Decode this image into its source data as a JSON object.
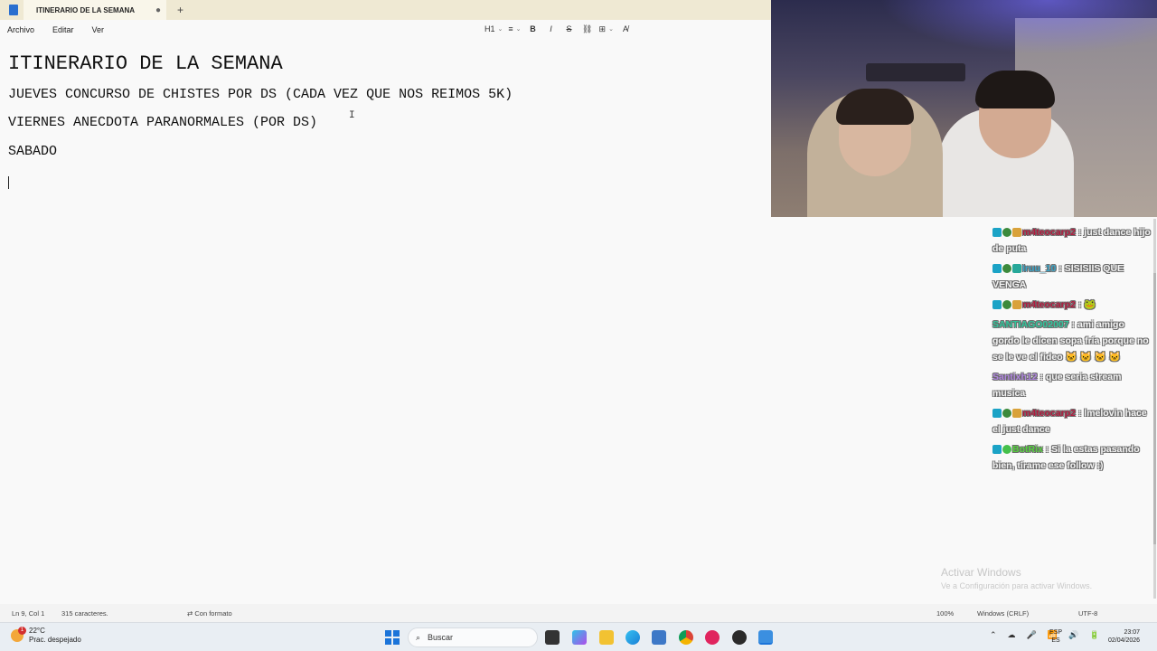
{
  "tab": {
    "title": "ITINERARIO DE LA SEMANA",
    "unsaved_dot": "●",
    "new_tab": "+"
  },
  "menu": {
    "file": "Archivo",
    "edit": "Editar",
    "view": "Ver"
  },
  "toolbar": {
    "heading": "H1",
    "list": "≡",
    "bold": "B",
    "italic": "I",
    "strike": "S",
    "link": "⛓",
    "table": "⊞",
    "clear": "A̸",
    "caret": "⌄"
  },
  "document": {
    "title": "ITINERARIO DE LA SEMANA",
    "lines": [
      "JUEVES CONCURSO DE CHISTES POR DS (CADA VEZ QUE NOS REIMOS 5K)",
      "VIERNES ANECDOTA PARANORMALES (POR DS)",
      "SABADO"
    ]
  },
  "chat": [
    {
      "user": "m4teocarp2",
      "user_color": "#b31b3f",
      "badges": [
        "mod",
        "tree",
        "gift"
      ],
      "text": " : just dance hijo de puta"
    },
    {
      "user": "Iruu_10",
      "user_color": "#39a5c9",
      "badges": [
        "mod",
        "tree",
        "sub"
      ],
      "text": " : SISISIIS QUE VENGA"
    },
    {
      "user": "m4teocarp2",
      "user_color": "#b31b3f",
      "badges": [
        "mod",
        "tree",
        "gift"
      ],
      "text": " : 🐸"
    },
    {
      "user": "SANTIAGO02007",
      "user_color": "#2fc49a",
      "badges": [],
      "text": " : ami amigo gordo le dicen sopa fría porque no se le ve el fideo 🐱 🐱 🐱 🐱"
    },
    {
      "user": "Santixh12",
      "user_color": "#b085e0",
      "badges": [],
      "text": " : que seria stream musica"
    },
    {
      "user": "m4teocarp2",
      "user_color": "#b31b3f",
      "badges": [
        "mod",
        "tree",
        "gift"
      ],
      "text": " : lmelovin hace el just dance"
    },
    {
      "user": "BotRix",
      "user_color": "#54d43b",
      "badges": [
        "mod",
        "verified"
      ],
      "text": " : Si la estas pasando bien, tírame ese follow :)"
    }
  ],
  "watermark": {
    "line1": "Activar Windows",
    "line2": "Ve a Configuración para activar Windows."
  },
  "status": {
    "position": "Ln 9, Col 1",
    "chars": "315 caracteres.",
    "format": "Con formato",
    "zoom": "100%",
    "eol": "Windows (CRLF)",
    "encoding": "UTF-8"
  },
  "taskbar": {
    "temp": "22°C",
    "weather": "Prac. despejado",
    "notif_count": "1",
    "search_placeholder": "Buscar",
    "search_icon": "⌕",
    "lang1": "ESP",
    "lang2": "ES",
    "time": "23:07",
    "date": "02/04/2026",
    "tray_icons": [
      "⌃",
      "☁",
      "🎤",
      "📶",
      "🔊",
      "🔋"
    ]
  }
}
